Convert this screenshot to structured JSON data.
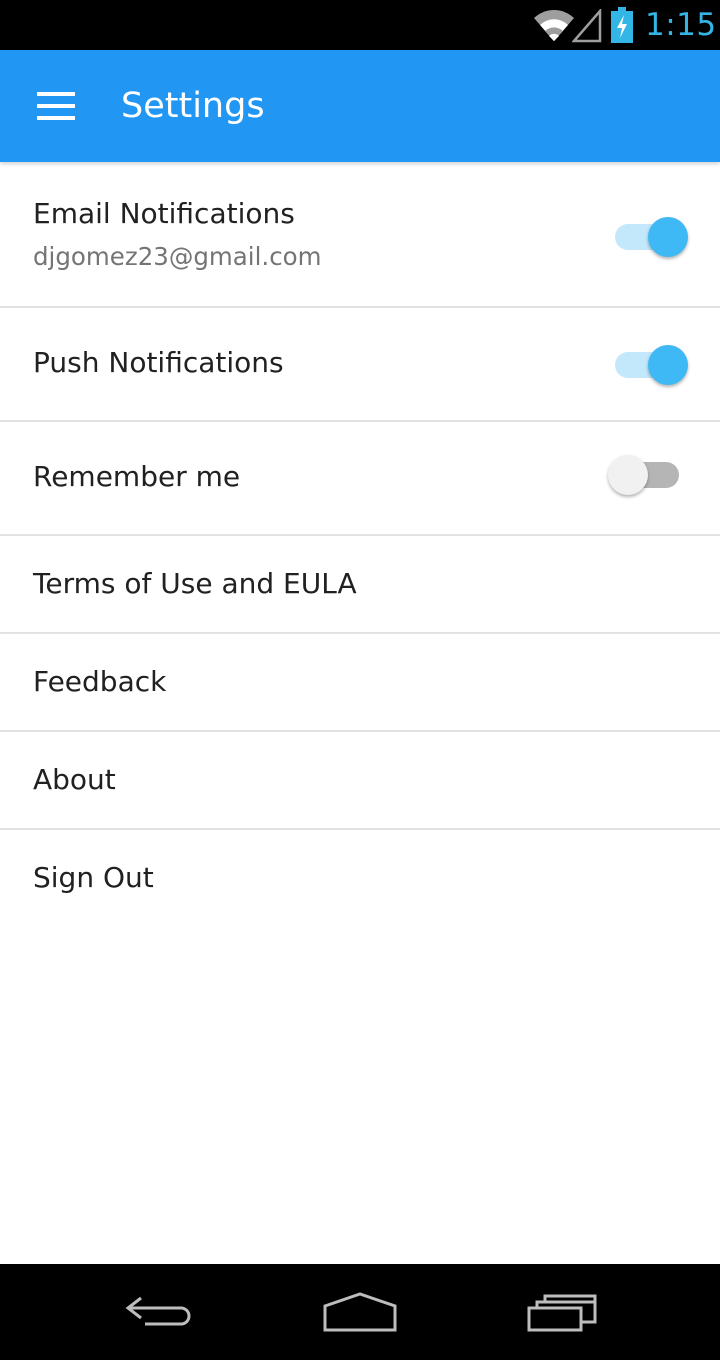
{
  "status_bar": {
    "time": "1:15",
    "icons": [
      "wifi-icon",
      "cell-signal-icon",
      "battery-charging-icon"
    ],
    "time_color": "#33b5e5"
  },
  "app_bar": {
    "title": "Settings",
    "menu_icon": "hamburger-menu-icon",
    "background_color": "#2196f3"
  },
  "settings": {
    "email_notifications": {
      "label": "Email Notifications",
      "email": "djgomez23@gmail.com",
      "enabled": true
    },
    "push_notifications": {
      "label": "Push Notifications",
      "enabled": true
    },
    "remember_me": {
      "label": "Remember me",
      "enabled": false
    },
    "terms": {
      "label": "Terms of Use and EULA"
    },
    "feedback": {
      "label": "Feedback"
    },
    "about": {
      "label": "About"
    },
    "sign_out": {
      "label": "Sign Out"
    }
  },
  "toggle_colors": {
    "on_thumb": "#3fb9f6",
    "on_track": "#c3e7fb",
    "off_thumb": "#f1f1f1",
    "off_track": "#b5b5b5"
  },
  "nav_bar": {
    "icons": [
      "back-icon",
      "home-icon",
      "recent-apps-icon"
    ]
  }
}
